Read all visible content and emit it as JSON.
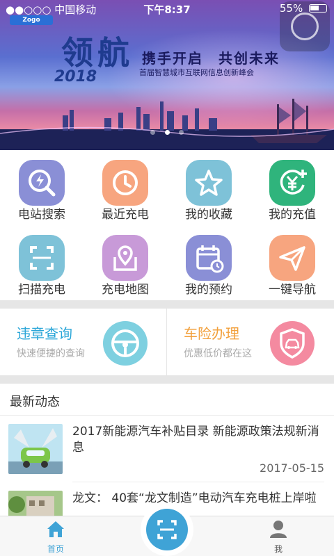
{
  "status_bar": {
    "carrier": "●●○○○ 中国移动",
    "time": "下午8:37",
    "battery": "55%"
  },
  "banner": {
    "logo_text": "Zogo",
    "title": "领航",
    "year": "2018",
    "slogan": "携手开启　共创未来",
    "summit": "首届智慧城市互联网信息创新峰会",
    "dots": 3,
    "active_dot": 1
  },
  "grid": {
    "items": [
      {
        "label": "电站搜索",
        "icon": "search-lightning-icon",
        "color": "#8a8fd6"
      },
      {
        "label": "最近充电",
        "icon": "clock-icon",
        "color": "#f7a57f"
      },
      {
        "label": "我的收藏",
        "icon": "star-icon",
        "color": "#7ec2d8"
      },
      {
        "label": "我的充值",
        "icon": "yuan-plus-icon",
        "color": "#2fb47c"
      },
      {
        "label": "扫描充电",
        "icon": "scan-icon",
        "color": "#7ec2d8"
      },
      {
        "label": "充电地图",
        "icon": "map-pin-icon",
        "color": "#c89ad8"
      },
      {
        "label": "我的预约",
        "icon": "calendar-clock-icon",
        "color": "#8a8fd6"
      },
      {
        "label": "一键导航",
        "icon": "paper-plane-icon",
        "color": "#f7a57f"
      }
    ]
  },
  "services": [
    {
      "title": "违章查询",
      "subtitle": "快速便捷的查询",
      "icon": "steering-wheel-icon",
      "color": "#2aa6d8",
      "icon_bg": "#7ed0e0"
    },
    {
      "title": "车险办理",
      "subtitle": "优惠低价都在这",
      "icon": "car-shield-icon",
      "color": "#f2a03c",
      "icon_bg": "#f48aa0"
    }
  ],
  "news": {
    "header": "最新动态",
    "items": [
      {
        "title": "2017新能源汽车补贴目录 新能源政策法规新消息",
        "date": "2017-05-15"
      },
      {
        "title": "龙文：  40套“龙文制造”电动汽车充电桩上岸啦",
        "date": ""
      }
    ]
  },
  "tabbar": {
    "home": "首页",
    "me": "我",
    "active_color": "#3fa3d6"
  }
}
